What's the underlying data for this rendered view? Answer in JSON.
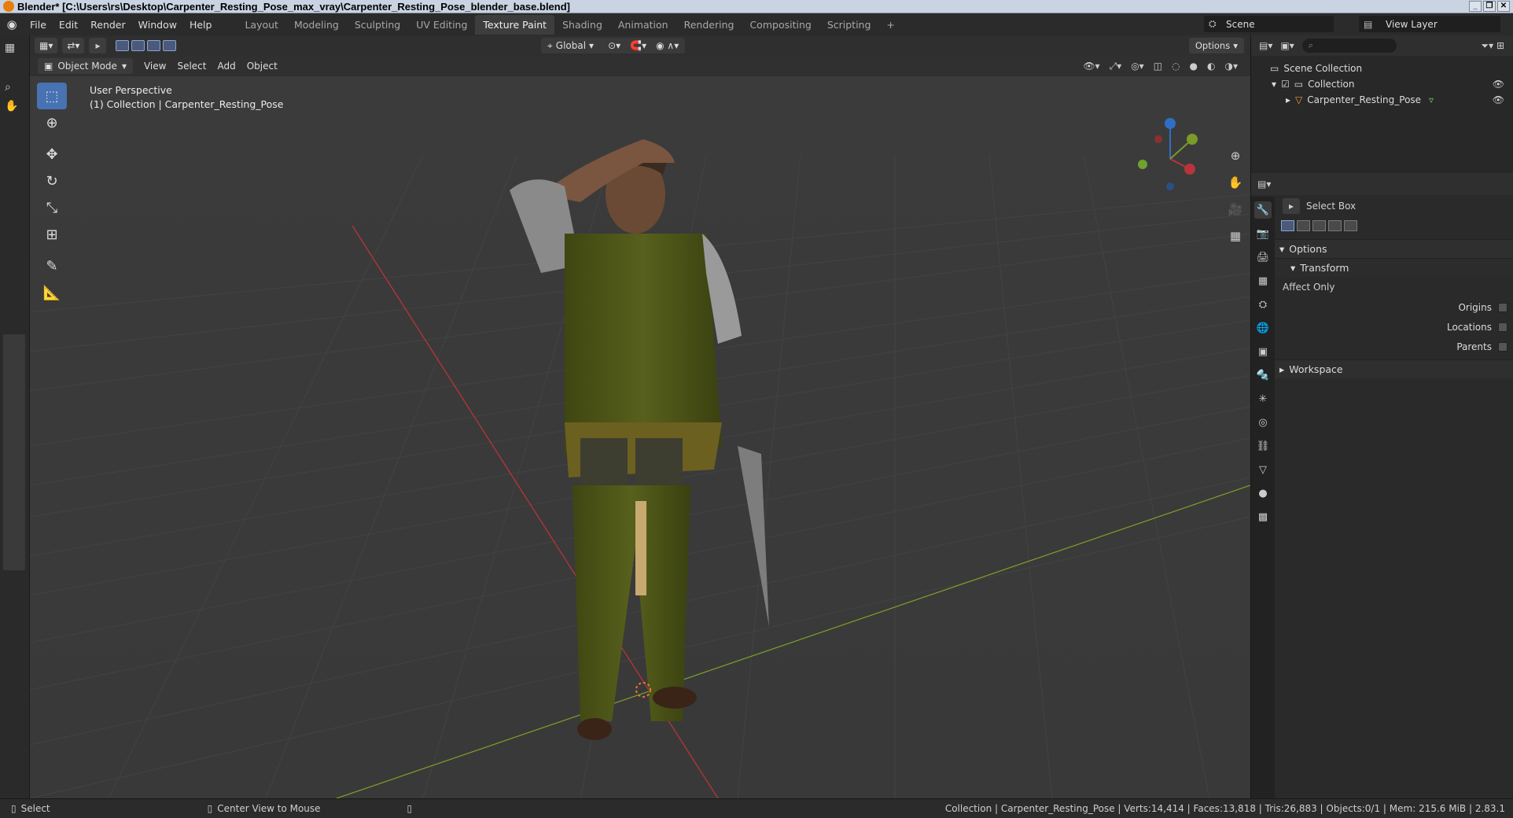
{
  "window": {
    "title": "Blender* [C:\\Users\\rs\\Desktop\\Carpenter_Resting_Pose_max_vray\\Carpenter_Resting_Pose_blender_base.blend]"
  },
  "menus": [
    "File",
    "Edit",
    "Render",
    "Window",
    "Help"
  ],
  "workspace_tabs": [
    "Layout",
    "Modeling",
    "Sculpting",
    "UV Editing",
    "Texture Paint",
    "Shading",
    "Animation",
    "Rendering",
    "Compositing",
    "Scripting"
  ],
  "active_workspace": "Texture Paint",
  "scene": {
    "label": "Scene"
  },
  "view_layer": {
    "label": "View Layer"
  },
  "viewport": {
    "mode": "Object Mode",
    "menus": [
      "View",
      "Select",
      "Add",
      "Object"
    ],
    "transform_orientation": "Global",
    "options_label": "Options",
    "overlay_line1": "User Perspective",
    "overlay_line2": "(1) Collection | Carpenter_Resting_Pose"
  },
  "outliner": {
    "root": "Scene Collection",
    "collection": "Collection",
    "object": "Carpenter_Resting_Pose"
  },
  "properties": {
    "tool_name": "Select Box",
    "options_section": "Options",
    "transform_subsection": "Transform",
    "affect_only": "Affect Only",
    "origins": "Origins",
    "locations": "Locations",
    "parents": "Parents",
    "workspace_section": "Workspace"
  },
  "statusbar": {
    "select": "Select",
    "center_view": "Center View to Mouse",
    "stats": "Collection | Carpenter_Resting_Pose | Verts:14,414 | Faces:13,818 | Tris:26,883 | Objects:0/1 | Mem: 215.6 MiB | 2.83.1"
  },
  "colors": {
    "accent": "#4772b3",
    "x_axis": "#b8343a",
    "y_axis": "#7a9a2a",
    "z_axis": "#2e6fc4"
  },
  "icons": [
    "blender-logo-icon",
    "select-box-icon",
    "cursor-icon",
    "move-icon",
    "rotate-icon",
    "scale-icon",
    "transform-icon",
    "annotate-icon",
    "measure-icon",
    "zoom-icon",
    "hand-icon",
    "camera-icon",
    "grid-icon",
    "eye-icon",
    "search-icon"
  ]
}
